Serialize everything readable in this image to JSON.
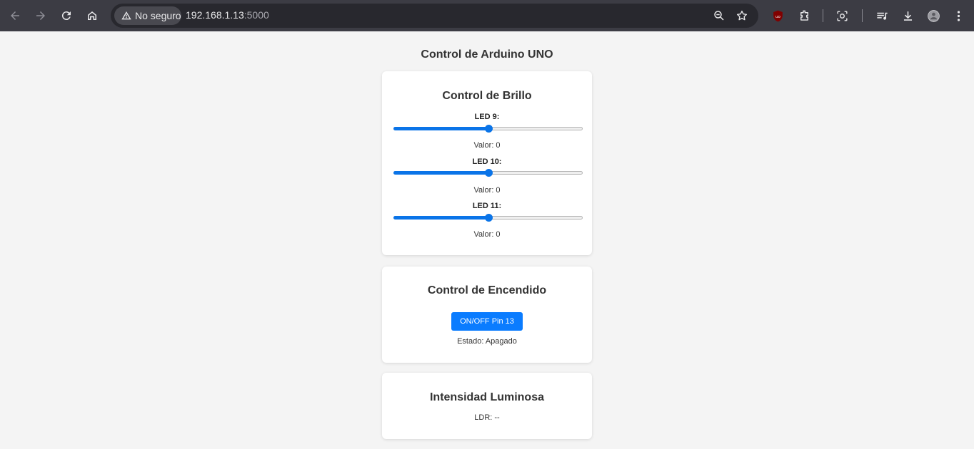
{
  "browser": {
    "security_label": "No seguro",
    "url_host": "192.168.1.13",
    "url_port": ":5000"
  },
  "page": {
    "title": "Control de Arduino UNO"
  },
  "brightness": {
    "title": "Control de Brillo",
    "leds": [
      {
        "label": "LED 9:",
        "value_text": "Valor: 0",
        "slider_level": 0.5
      },
      {
        "label": "LED 10:",
        "value_text": "Valor: 0",
        "slider_level": 0.5
      },
      {
        "label": "LED 11:",
        "value_text": "Valor: 0",
        "slider_level": 0.5
      }
    ]
  },
  "power": {
    "title": "Control de Encendido",
    "button_label": "ON/OFF Pin 13",
    "status_text": "Estado: Apagado"
  },
  "light": {
    "title": "Intensidad Luminosa",
    "ldr_text": "LDR: --"
  },
  "colors": {
    "accent": "#0a74e8",
    "button": "#0a7cff",
    "toolbar": "#3c3c44"
  }
}
